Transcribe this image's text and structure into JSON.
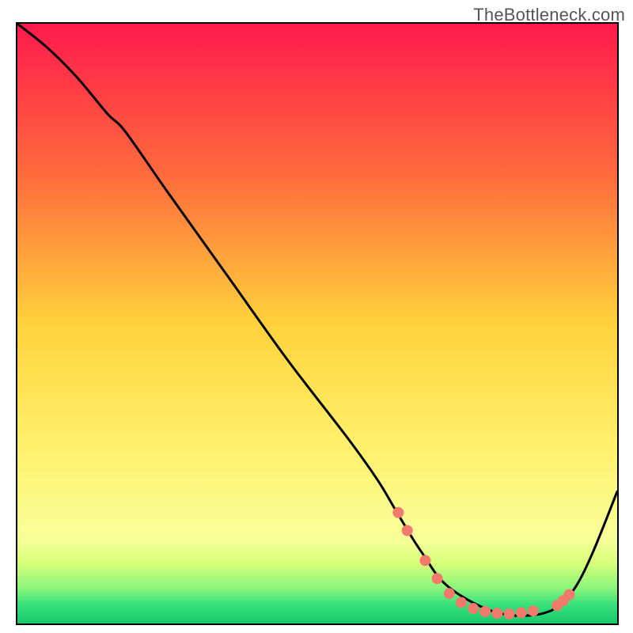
{
  "watermark": "TheBottleneck.com",
  "chart_data": {
    "type": "line",
    "title": "",
    "xlabel": "",
    "ylabel": "",
    "xlim": [
      0,
      100
    ],
    "ylim": [
      0,
      100
    ],
    "gradient_stops": [
      {
        "offset": 0,
        "color": "#ff1a4d"
      },
      {
        "offset": 25,
        "color": "#ff6a3c"
      },
      {
        "offset": 50,
        "color": "#ffd23c"
      },
      {
        "offset": 70,
        "color": "#fff06a"
      },
      {
        "offset": 86,
        "color": "#f8ff9a"
      },
      {
        "offset": 90,
        "color": "#d6ff7a"
      },
      {
        "offset": 94,
        "color": "#8cf57a"
      },
      {
        "offset": 97,
        "color": "#34e07a"
      },
      {
        "offset": 100,
        "color": "#18c86a"
      }
    ],
    "series": [
      {
        "name": "bottleneck-curve",
        "x": [
          0,
          5,
          10,
          15,
          18,
          25,
          35,
          45,
          55,
          60,
          63,
          66,
          68,
          70,
          72,
          75,
          78,
          80,
          82,
          84,
          86,
          88,
          90,
          93,
          96,
          100
        ],
        "y": [
          100,
          96,
          91,
          85,
          82,
          72,
          58,
          44,
          31,
          24,
          19,
          14,
          11,
          8,
          6,
          4,
          2.5,
          1.8,
          1.4,
          1.3,
          1.4,
          1.8,
          2.8,
          6,
          12,
          22
        ]
      }
    ],
    "markers": {
      "name": "highlight-dots",
      "color": "#f17a6d",
      "radius": 7,
      "points": [
        {
          "x": 63.5,
          "y": 18.5
        },
        {
          "x": 65.0,
          "y": 15.5
        },
        {
          "x": 68.0,
          "y": 10.5
        },
        {
          "x": 70.0,
          "y": 7.5
        },
        {
          "x": 72.0,
          "y": 5.0
        },
        {
          "x": 74.0,
          "y": 3.5
        },
        {
          "x": 76.0,
          "y": 2.5
        },
        {
          "x": 78.0,
          "y": 2.0
        },
        {
          "x": 80.0,
          "y": 1.7
        },
        {
          "x": 82.0,
          "y": 1.6
        },
        {
          "x": 84.0,
          "y": 1.8
        },
        {
          "x": 86.0,
          "y": 2.1
        },
        {
          "x": 90.0,
          "y": 3.0
        },
        {
          "x": 91.0,
          "y": 3.8
        },
        {
          "x": 92.0,
          "y": 4.8
        }
      ]
    }
  }
}
